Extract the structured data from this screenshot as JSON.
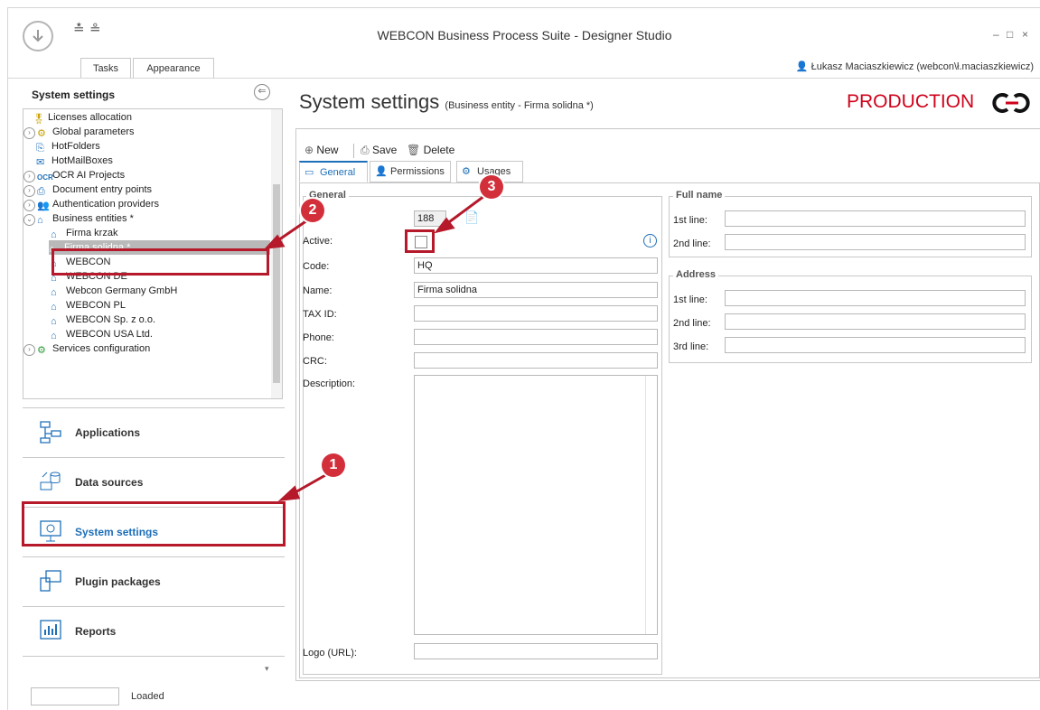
{
  "window": {
    "title": "WEBCON Business Process Suite - Designer Studio",
    "tabs": [
      "Tasks",
      "Appearance"
    ],
    "user": "Łukasz Maciaszkiewicz (webcon\\ł.maciaszkiewicz)",
    "controls": {
      "minimize": "–",
      "maximize": "□",
      "close": "×"
    }
  },
  "left": {
    "header": "System settings",
    "tree": [
      {
        "label": "Licenses allocation",
        "icon": "license-icon",
        "expand": false
      },
      {
        "label": "Global parameters",
        "icon": "gear-icon",
        "expand": true
      },
      {
        "label": "HotFolders",
        "icon": "hotfolder-icon",
        "expand": false
      },
      {
        "label": "HotMailBoxes",
        "icon": "mailbox-icon",
        "expand": false
      },
      {
        "label": "OCR AI Projects",
        "icon": "ocr-icon",
        "expand": true
      },
      {
        "label": "Document entry points",
        "icon": "printer-icon",
        "expand": true
      },
      {
        "label": "Authentication providers",
        "icon": "users-icon",
        "expand": true
      },
      {
        "label": "Business entities *",
        "icon": "home-icon",
        "expand": true
      },
      {
        "label": "Firma krzak",
        "icon": "home-icon",
        "child": true
      },
      {
        "label": "Firma solidna *",
        "icon": "home-icon",
        "child": true,
        "selected": true
      },
      {
        "label": "WEBCON",
        "icon": "home-icon",
        "child": true
      },
      {
        "label": "WEBCON DE",
        "icon": "home-icon",
        "child": true
      },
      {
        "label": "Webcon Germany GmbH",
        "icon": "home-icon",
        "child": true
      },
      {
        "label": "WEBCON PL",
        "icon": "home-icon",
        "child": true
      },
      {
        "label": "WEBCON Sp. z o.o.",
        "icon": "home-icon",
        "child": true
      },
      {
        "label": "WEBCON USA Ltd.",
        "icon": "home-icon",
        "child": true
      },
      {
        "label": "Services configuration",
        "icon": "services-icon",
        "expand": true
      }
    ],
    "nav": [
      "Applications",
      "Data sources",
      "System settings",
      "Plugin packages",
      "Reports"
    ],
    "status": "Loaded"
  },
  "main": {
    "title": "System settings",
    "subtitle": "(Business entity - Firma solidna *)",
    "env": "PRODUCTION",
    "toolbar": {
      "new": "New",
      "save": "Save",
      "delete": "Delete"
    },
    "tabs": [
      "General",
      "Permissions",
      "Usages"
    ],
    "general": {
      "group": "General",
      "id_value": "188",
      "fields": {
        "active": "Active:",
        "code": "Code:",
        "name": "Name:",
        "taxid": "TAX ID:",
        "phone": "Phone:",
        "crc": "CRC:",
        "description": "Description:",
        "logo": "Logo (URL):"
      },
      "values": {
        "code": "HQ",
        "name": "Firma solidna",
        "taxid": "",
        "phone": "",
        "crc": "",
        "logo": ""
      }
    },
    "fullname": {
      "group": "Full name",
      "line1": "1st line:",
      "line2": "2nd line:"
    },
    "address": {
      "group": "Address",
      "line1": "1st line:",
      "line2": "2nd line:",
      "line3": "3rd line:"
    }
  },
  "annotations": [
    "1",
    "2",
    "3"
  ],
  "colors": {
    "accent": "#d32f3b",
    "production": "#d0021b",
    "tab_active": "#1e6fb8"
  }
}
